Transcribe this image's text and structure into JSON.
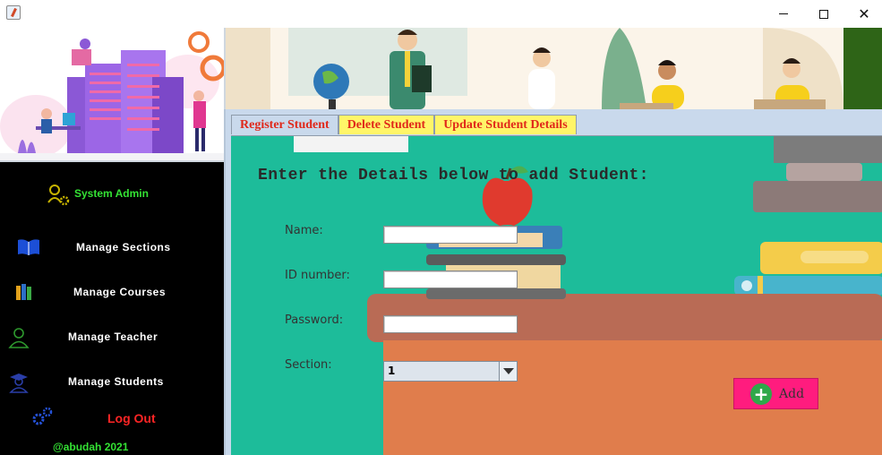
{
  "window": {
    "minimize_glyph": "",
    "maximize_glyph": "",
    "close_glyph": "✕"
  },
  "sidebar": {
    "admin_label": "System Admin",
    "items": [
      {
        "label": "Manage  Sections",
        "icon": "book-icon"
      },
      {
        "label": "Manage Courses",
        "icon": "books-icon"
      },
      {
        "label": "Manage Teacher",
        "icon": "teacher-icon"
      },
      {
        "label": "Manage Students",
        "icon": "student-icon"
      }
    ],
    "logout_label": "Log Out",
    "copyright": "@abudah 2021"
  },
  "tabs": [
    {
      "label": "Register Student",
      "active": true
    },
    {
      "label": "Delete Student",
      "active": false
    },
    {
      "label": "Update Student Details",
      "active": false
    }
  ],
  "form": {
    "heading": "Enter the Details below to add Student:",
    "name_label": "Name:",
    "name_value": "",
    "id_label": "ID number:",
    "id_value": "",
    "password_label": "Password:",
    "password_value": "",
    "section_label": "Section:",
    "section_value": "1",
    "add_label": "Add",
    "add_glyph": "+"
  },
  "colors": {
    "accent_green": "#34e234",
    "logout_red": "#ff2525",
    "tab_yellow": "#fff568",
    "tab_text_red": "#e0281a",
    "content_teal": "#1dbc9a",
    "add_pink": "#ff1c7e"
  }
}
